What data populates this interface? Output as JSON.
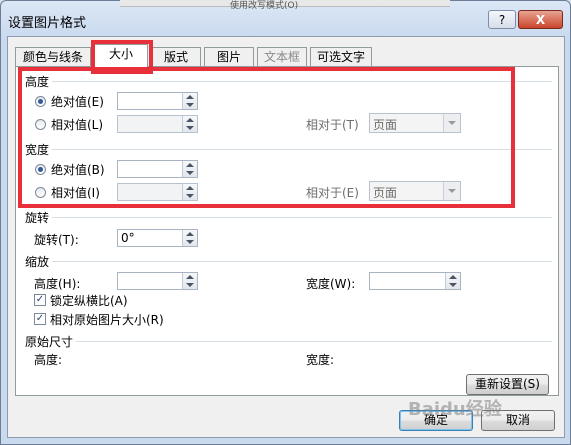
{
  "window": {
    "background_label": "使用改写模式(O)",
    "title": "设置图片格式",
    "help_label": "?",
    "close_label": "X"
  },
  "tabs": [
    "颜色与线条",
    "大小",
    "版式",
    "图片",
    "文本框",
    "可选文字"
  ],
  "active_tab": "大小",
  "height_section": {
    "title": "高度",
    "absolute": {
      "label": "绝对值(E)",
      "value": "",
      "selected": true
    },
    "relative": {
      "label": "相对值(L)",
      "value": "",
      "selected": false
    },
    "relative_to_label": "相对于(T)",
    "relative_to_value": "页面"
  },
  "width_section": {
    "title": "宽度",
    "absolute": {
      "label": "绝对值(B)",
      "value": "",
      "selected": true
    },
    "relative": {
      "label": "相对值(I)",
      "value": "",
      "selected": false
    },
    "relative_to_label": "相对于(E)",
    "relative_to_value": "页面"
  },
  "rotation": {
    "title": "旋转",
    "label": "旋转(T):",
    "value": "0°"
  },
  "scale": {
    "title": "缩放",
    "height_label": "高度(H):",
    "height_value": "",
    "width_label": "宽度(W):",
    "width_value": "",
    "lock_aspect": {
      "label": "锁定纵横比(A)",
      "checked": true
    },
    "relative_original": {
      "label": "相对原始图片大小(R)",
      "checked": true
    }
  },
  "original_size": {
    "title": "原始尺寸",
    "height_label": "高度:",
    "width_label": "宽度:"
  },
  "buttons": {
    "reset": "重新设置(S)",
    "ok": "确定",
    "cancel": "取消"
  },
  "watermark": "Baidu经验",
  "colors": {
    "highlight": "#e8303a",
    "title_bar": "#c9d9ee",
    "close_button": "#c9452b"
  }
}
